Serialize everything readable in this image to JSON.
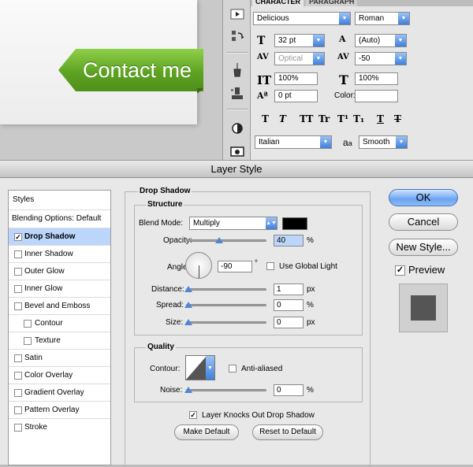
{
  "contact_button": {
    "label": "Contact me"
  },
  "character_panel": {
    "tabs": [
      "CHARACTER",
      "PARAGRAPH"
    ],
    "font_family": "Delicious",
    "font_style": "Roman",
    "font_size": "32 pt",
    "leading": "(Auto)",
    "kerning": "Optical",
    "tracking": "-50",
    "vertical_scale": "100%",
    "horizontal_scale": "100%",
    "baseline_shift": "0 pt",
    "color_label": "Color:",
    "language": "Italian",
    "aa_label": "a",
    "anti_alias": "Smooth",
    "style_buttons": [
      "T",
      "T",
      "TT",
      "Tr",
      "T¹",
      "T₁",
      "T",
      "T"
    ]
  },
  "dialog": {
    "title": "Layer Style",
    "styles_header": "Styles",
    "blending_options": "Blending Options: Default",
    "style_items": [
      {
        "label": "Drop Shadow",
        "checked": true,
        "selected": true
      },
      {
        "label": "Inner Shadow",
        "checked": false
      },
      {
        "label": "Outer Glow",
        "checked": false
      },
      {
        "label": "Inner Glow",
        "checked": false
      },
      {
        "label": "Bevel and Emboss",
        "checked": false
      },
      {
        "label": "Contour",
        "checked": false,
        "indent": true
      },
      {
        "label": "Texture",
        "checked": false,
        "indent": true
      },
      {
        "label": "Satin",
        "checked": false
      },
      {
        "label": "Color Overlay",
        "checked": false
      },
      {
        "label": "Gradient Overlay",
        "checked": false
      },
      {
        "label": "Pattern Overlay",
        "checked": false
      },
      {
        "label": "Stroke",
        "checked": false
      }
    ],
    "drop_shadow": {
      "title": "Drop Shadow",
      "structure_title": "Structure",
      "blend_mode_label": "Blend Mode:",
      "blend_mode": "Multiply",
      "shadow_color": "#000000",
      "opacity_label": "Opacity:",
      "opacity": "40",
      "angle_label": "Angle:",
      "angle": "-90",
      "degree": "°",
      "use_global_light": "Use Global Light",
      "distance_label": "Distance:",
      "distance": "1",
      "spread_label": "Spread:",
      "spread": "0",
      "size_label": "Size:",
      "size": "0",
      "unit_px": "px",
      "unit_pct": "%",
      "quality_title": "Quality",
      "contour_label": "Contour:",
      "anti_aliased": "Anti-aliased",
      "noise_label": "Noise:",
      "noise": "0",
      "knocks_out": "Layer Knocks Out Drop Shadow",
      "make_default": "Make Default",
      "reset_default": "Reset to Default"
    },
    "buttons": {
      "ok": "OK",
      "cancel": "Cancel",
      "new_style": "New Style...",
      "preview": "Preview"
    }
  }
}
